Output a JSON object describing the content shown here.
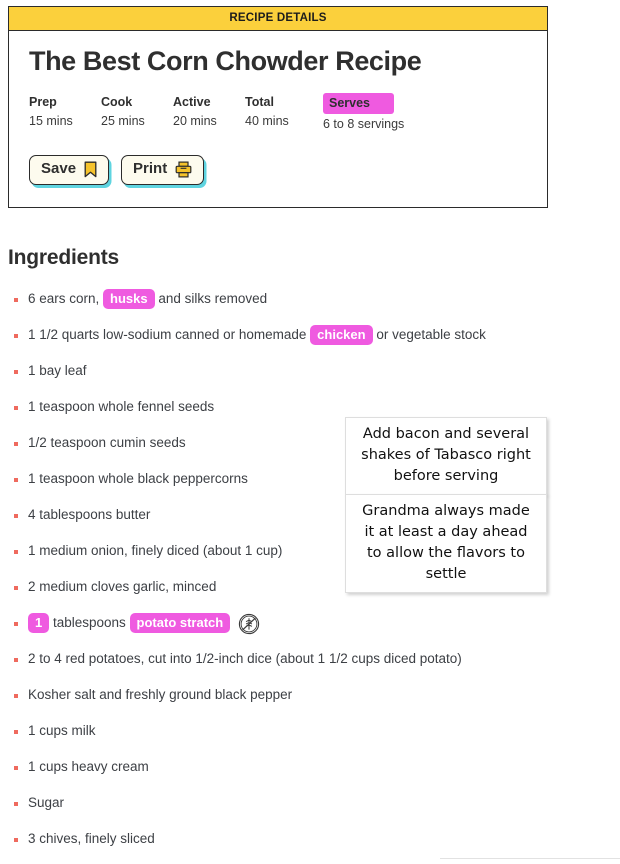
{
  "card": {
    "header_label": "RECIPE DETAILS",
    "title": "The Best Corn Chowder Recipe",
    "meta": [
      {
        "label": "Prep",
        "value": "15 mins"
      },
      {
        "label": "Cook",
        "value": "25 mins"
      },
      {
        "label": "Active",
        "value": "20 mins"
      },
      {
        "label": "Total",
        "value": "40 mins"
      }
    ],
    "serves": {
      "label": "Serves",
      "value": "6 to 8 servings"
    },
    "buttons": [
      {
        "label": "Save",
        "icon": "bookmark-icon"
      },
      {
        "label": "Print",
        "icon": "printer-icon"
      }
    ]
  },
  "ingredients": {
    "heading": "Ingredients",
    "items": [
      {
        "pre": "6 ears corn, ",
        "pill": "husks",
        "post": " and silks removed"
      },
      {
        "pre": "1 1/2 quarts low-sodium canned or homemade ",
        "pill": "chicken",
        "post": " or vegetable stock"
      },
      {
        "pre": "1 bay leaf",
        "pill": "",
        "post": ""
      },
      {
        "pre": "1 teaspoon whole fennel seeds",
        "pill": "",
        "post": ""
      },
      {
        "pre": "1/2 teaspoon cumin seeds",
        "pill": "",
        "post": ""
      },
      {
        "pre": "1 teaspoon whole black peppercorns",
        "pill": "",
        "post": ""
      },
      {
        "pre": "4 tablespoons butter",
        "pill": "",
        "post": ""
      },
      {
        "pre": "1 medium onion, finely diced (about 1 cup)",
        "pill": "",
        "post": ""
      },
      {
        "pre": "2 medium cloves garlic, minced",
        "pill": "",
        "post": ""
      },
      {
        "pre": "",
        "pill": "1",
        "post": " tablespoons ",
        "pill2": "potato stratch",
        "icon": "gluten-free-icon"
      },
      {
        "pre": "2 to 4 red potatoes, cut into 1/2-inch dice (about 1 1/2 cups diced potato)",
        "pill": "",
        "post": ""
      },
      {
        "pre": "Kosher salt and freshly ground black pepper",
        "pill": "",
        "post": ""
      },
      {
        "pre": "1 cups milk",
        "pill": "",
        "post": ""
      },
      {
        "pre": "1 cups heavy cream",
        "pill": "",
        "post": ""
      },
      {
        "pre": "Sugar",
        "pill": "",
        "post": ""
      },
      {
        "pre": "3 chives, finely sliced",
        "pill": "",
        "post": ""
      }
    ]
  },
  "notes": [
    {
      "text": "Add bacon and several shakes of Tabasco right before serving"
    },
    {
      "text": "Grandma always made it at least a day ahead to allow the flavors to settle"
    }
  ],
  "colors": {
    "header_yellow": "#FBD03C",
    "highlight_magenta": "#ef5ae0",
    "button_cream": "#FDFBEE",
    "button_shadow_teal": "#5fd4e0",
    "bullet_red": "#ef6a5e",
    "icon_yellow": "#F5C32C"
  }
}
